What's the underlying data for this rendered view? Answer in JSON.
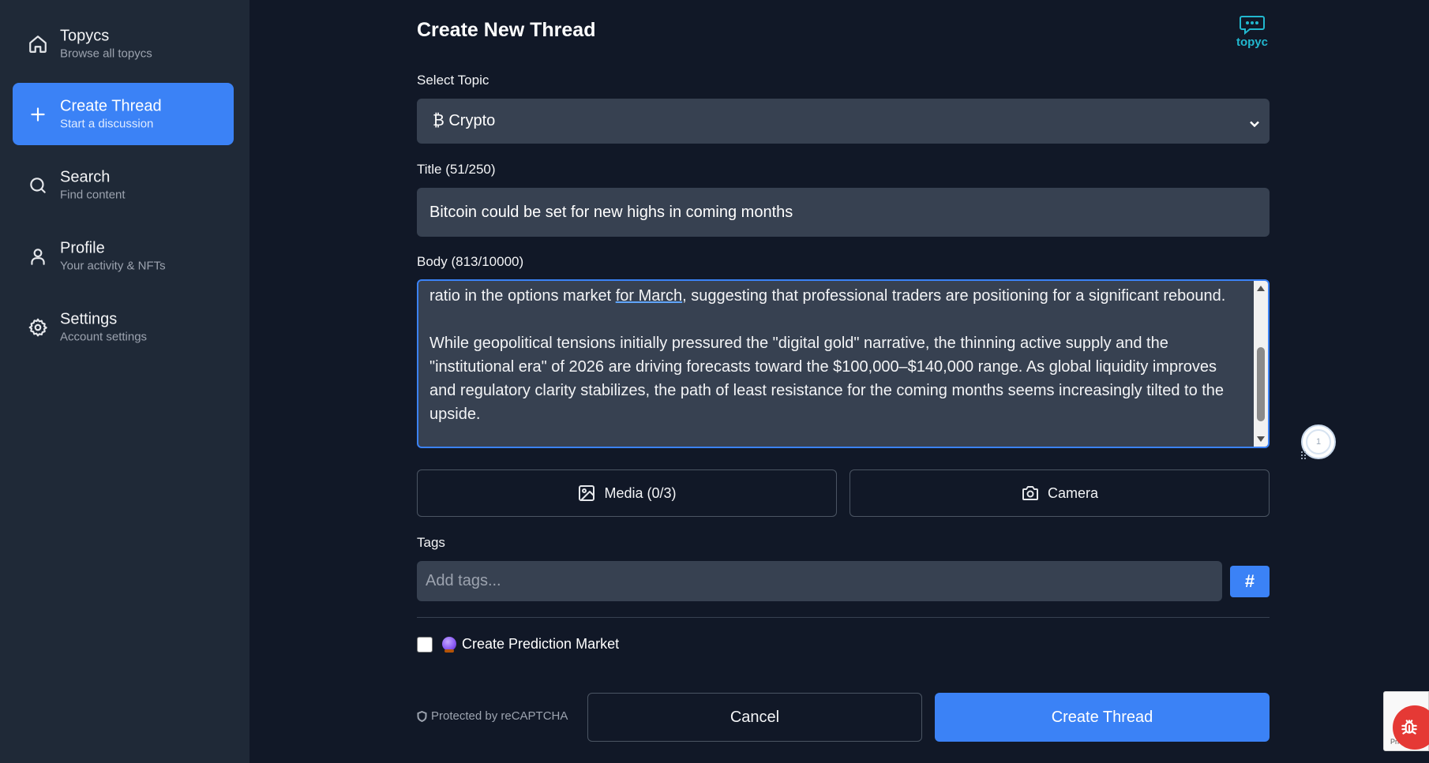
{
  "sidebar": {
    "items": [
      {
        "title": "Topycs",
        "subtitle": "Browse all topycs",
        "icon": "home-icon"
      },
      {
        "title": "Create Thread",
        "subtitle": "Start a discussion",
        "icon": "plus-icon",
        "active": true
      },
      {
        "title": "Search",
        "subtitle": "Find content",
        "icon": "search-icon"
      },
      {
        "title": "Profile",
        "subtitle": "Your activity & NFTs",
        "icon": "user-icon"
      },
      {
        "title": "Settings",
        "subtitle": "Account settings",
        "icon": "gear-icon"
      }
    ]
  },
  "header": {
    "title": "Create New Thread",
    "logo_text": "topyc"
  },
  "form": {
    "topic_label": "Select Topic",
    "topic_value": "₿ Crypto",
    "title_label": "Title (51/250)",
    "title_value": "Bitcoin could be set for new highs in coming months",
    "body_label": "Body (813/10000)",
    "body_line1_a": "ratio in the options market ",
    "body_line1_link": "for March",
    "body_line1_b": ", suggesting that professional traders are positioning for a significant rebound.",
    "body_para2": "While geopolitical tensions initially pressured the \"digital gold\" narrative, the thinning active supply and the \"institutional era\" of 2026 are driving forecasts toward the $100,000–$140,000 range. As global liquidity improves and regulatory clarity stabilizes, the path of least resistance for the coming months seems increasingly tilted to the upside.",
    "media_label": "Media (0/3)",
    "camera_label": "Camera",
    "tags_label": "Tags",
    "tags_placeholder": "Add tags...",
    "hash_label": "#",
    "prediction_label": "Create Prediction Market",
    "prediction_checked": false,
    "captcha_note": "Protected by reCAPTCHA",
    "cancel_label": "Cancel",
    "submit_label": "Create Thread"
  },
  "widgets": {
    "float_badge": "1",
    "recaptcha_text": "Pri"
  },
  "colors": {
    "background": "#111827",
    "sidebar": "#1f2937",
    "accent": "#3b82f6",
    "input": "#374151",
    "logo": "#22b8cf",
    "bug": "#e53935"
  }
}
